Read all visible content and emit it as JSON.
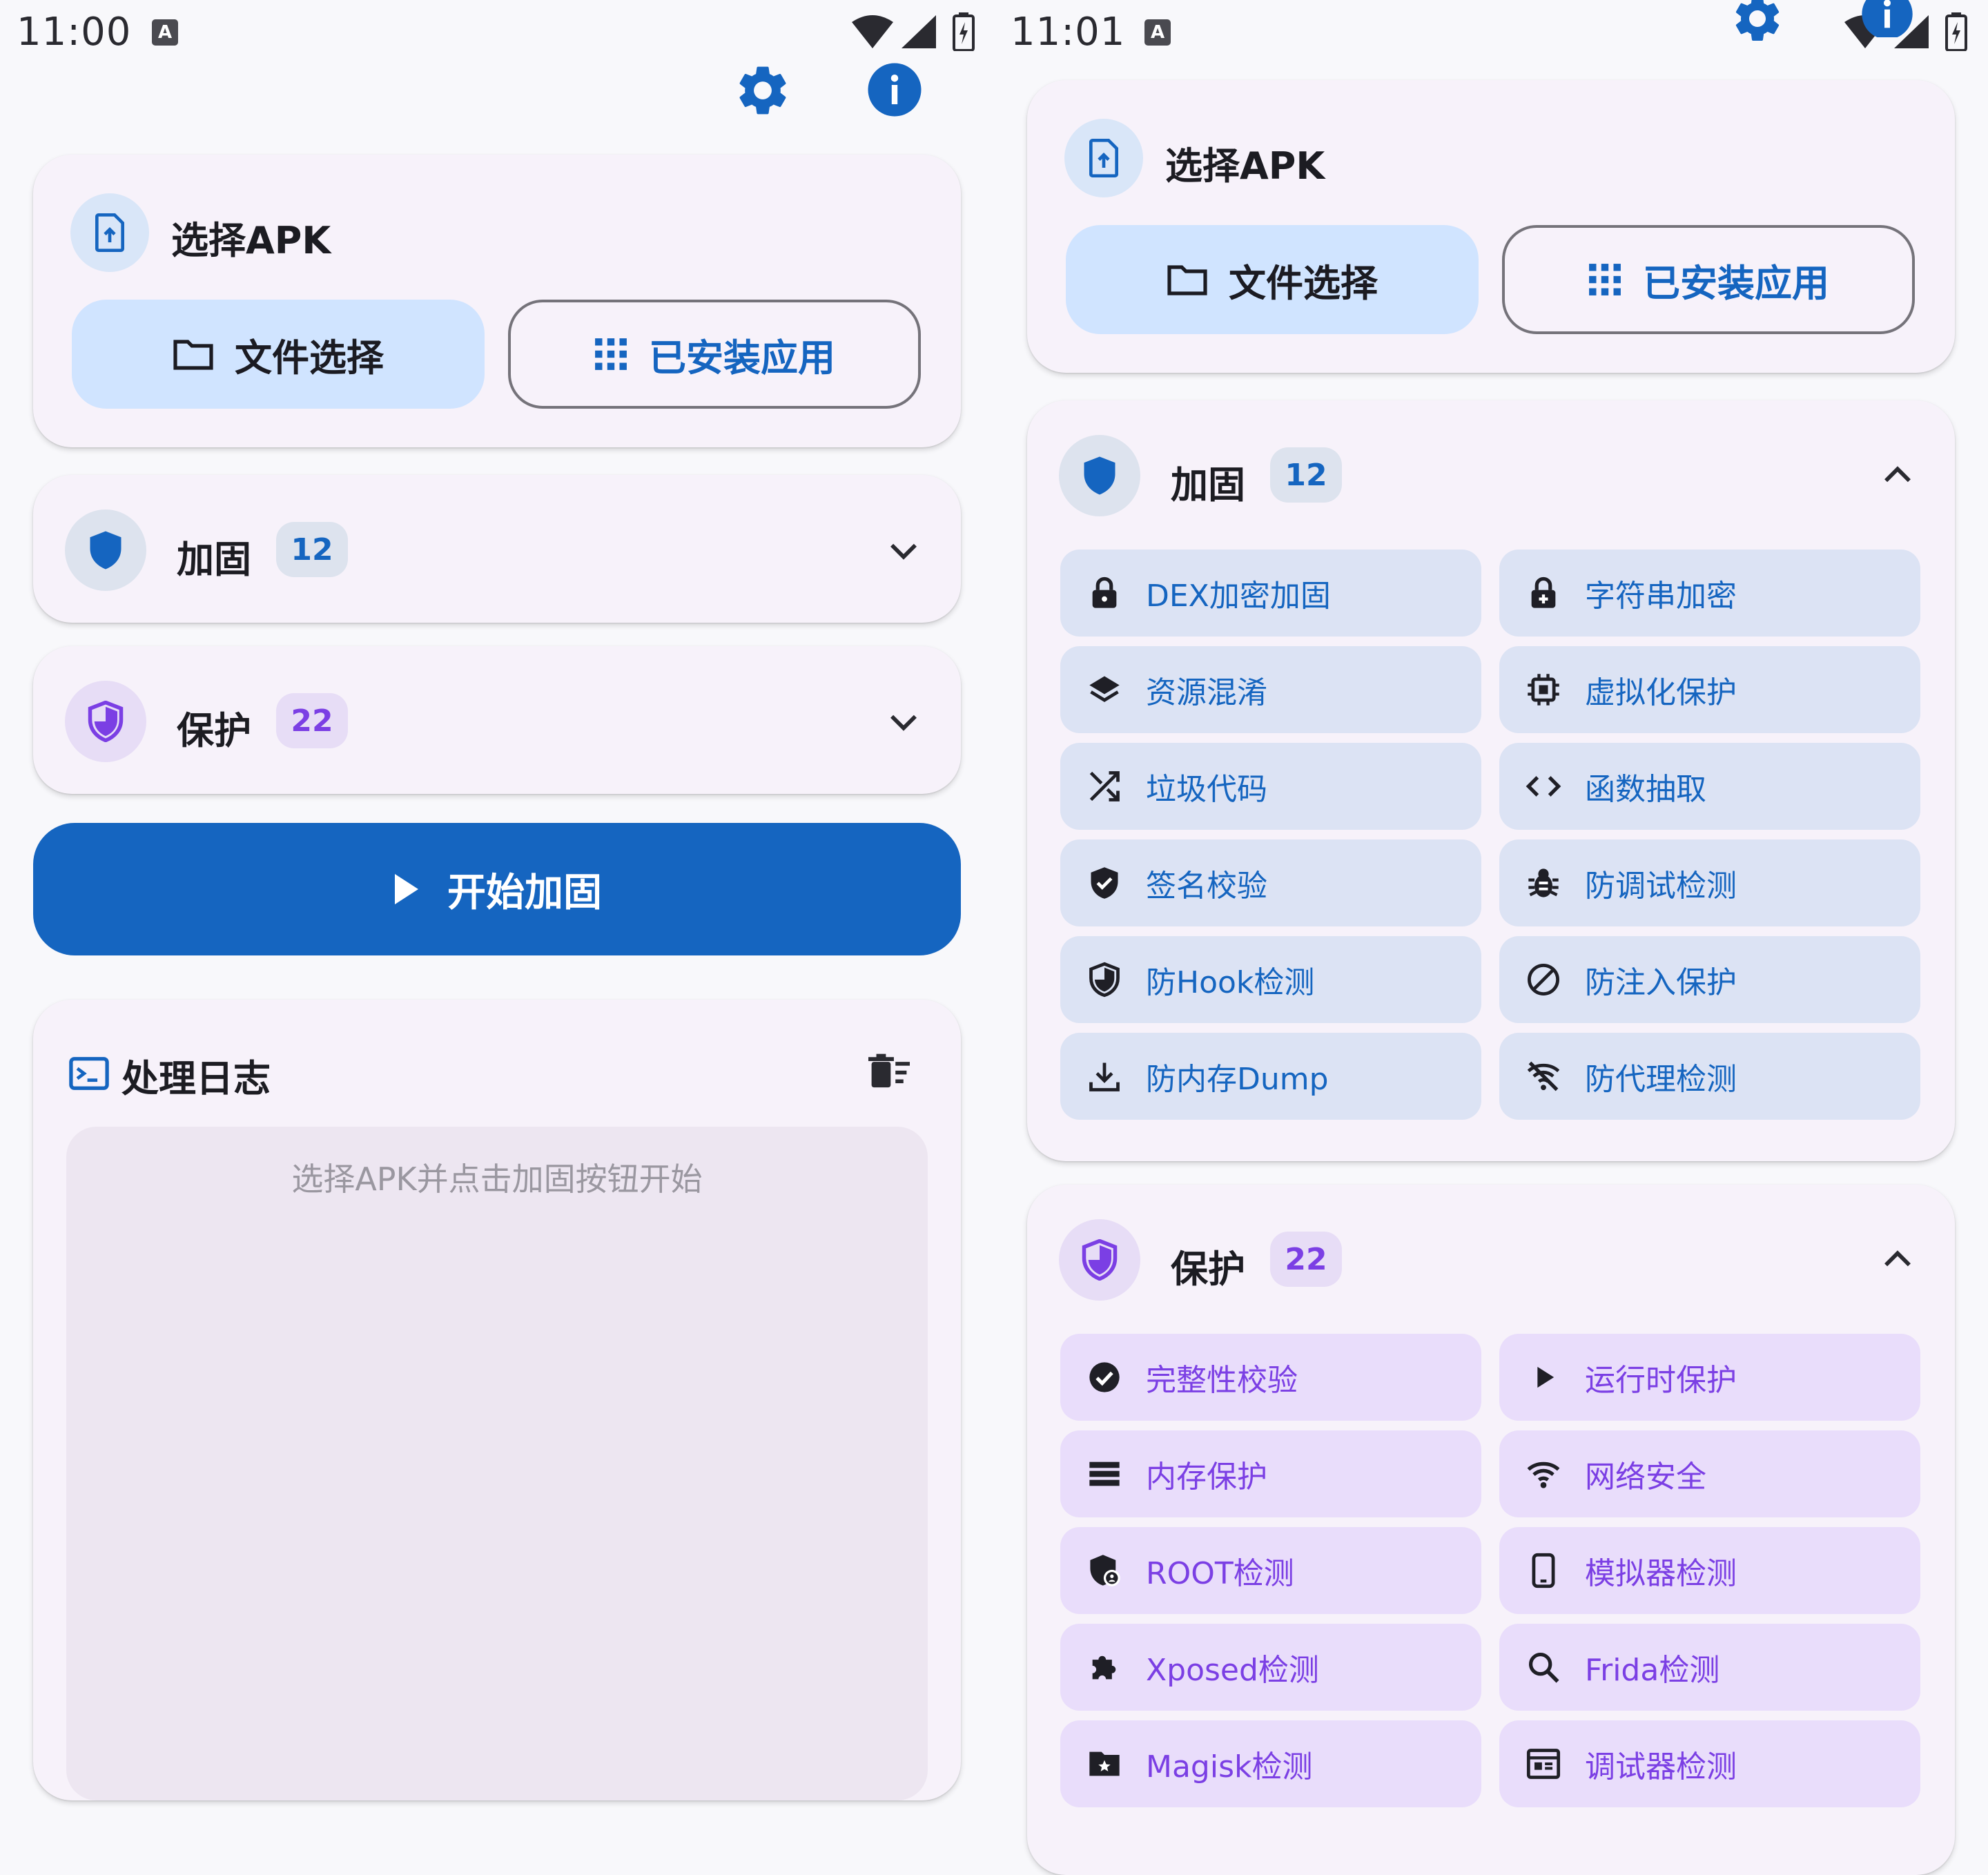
{
  "left": {
    "status": {
      "time": "11:00",
      "a_badge": "A"
    },
    "select_card": {
      "title": "选择APK",
      "file_button": "文件选择",
      "installed_button": "已安装应用"
    },
    "harden": {
      "title": "加固",
      "count": "12"
    },
    "protect": {
      "title": "保护",
      "count": "22"
    },
    "start_button": "开始加固",
    "log": {
      "title": "处理日志",
      "placeholder": "选择APK并点击加固按钮开始"
    }
  },
  "right": {
    "status": {
      "time": "11:01",
      "a_badge": "A"
    },
    "select_card": {
      "title": "选择APK",
      "file_button": "文件选择",
      "installed_button": "已安装应用"
    },
    "harden": {
      "title": "加固",
      "count": "12",
      "items": [
        "DEX加密加固",
        "字符串加密",
        "资源混淆",
        "虚拟化保护",
        "垃圾代码",
        "函数抽取",
        "签名校验",
        "防调试检测",
        "防Hook检测",
        "防注入保护",
        "防内存Dump",
        "防代理检测"
      ],
      "icons": [
        "lock-icon",
        "lock-plus-icon",
        "layers-icon",
        "chip-icon",
        "shuffle-icon",
        "code-icon",
        "verified-shield-icon",
        "bug-icon",
        "half-shield-icon",
        "block-icon",
        "download-icon",
        "wifi-off-icon"
      ]
    },
    "protect": {
      "title": "保护",
      "count": "22",
      "items": [
        "完整性校验",
        "运行时保护",
        "内存保护",
        "网络安全",
        "ROOT检测",
        "模拟器检测",
        "Xposed检测",
        "Frida检测",
        "Magisk检测",
        "调试器检测"
      ],
      "icons": [
        "check-circle-icon",
        "play-icon",
        "storage-icon",
        "wifi-icon",
        "root-shield-icon",
        "phone-icon",
        "puzzle-icon",
        "search-icon",
        "folder-star-icon",
        "debug-window-icon"
      ]
    }
  },
  "colors": {
    "primary": "#1565C0",
    "tonal": "#D0E4FF",
    "purple": "#7B3FE4",
    "chip_blue": "#DCE3F4",
    "chip_purple": "#E9DDFB"
  }
}
